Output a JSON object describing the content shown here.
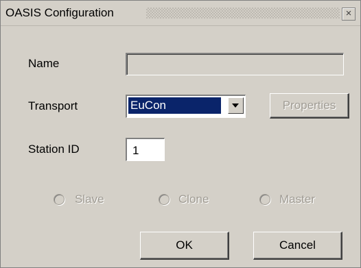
{
  "window": {
    "title": "OASIS Configuration",
    "close_glyph": "×"
  },
  "form": {
    "name_label": "Name",
    "name_value": "",
    "transport_label": "Transport",
    "transport_selected": "EuCon",
    "properties_label": "Properties",
    "station_label": "Station ID",
    "station_value": "1"
  },
  "role_options": [
    {
      "label": "Slave",
      "selected": false,
      "enabled": false
    },
    {
      "label": "Clone",
      "selected": false,
      "enabled": false
    },
    {
      "label": "Master",
      "selected": false,
      "enabled": false
    }
  ],
  "buttons": {
    "ok": "OK",
    "cancel": "Cancel"
  },
  "colors": {
    "dialog_bg": "#d4d0c8",
    "selection_bg": "#0a246a",
    "disabled_text": "#a09c94"
  }
}
